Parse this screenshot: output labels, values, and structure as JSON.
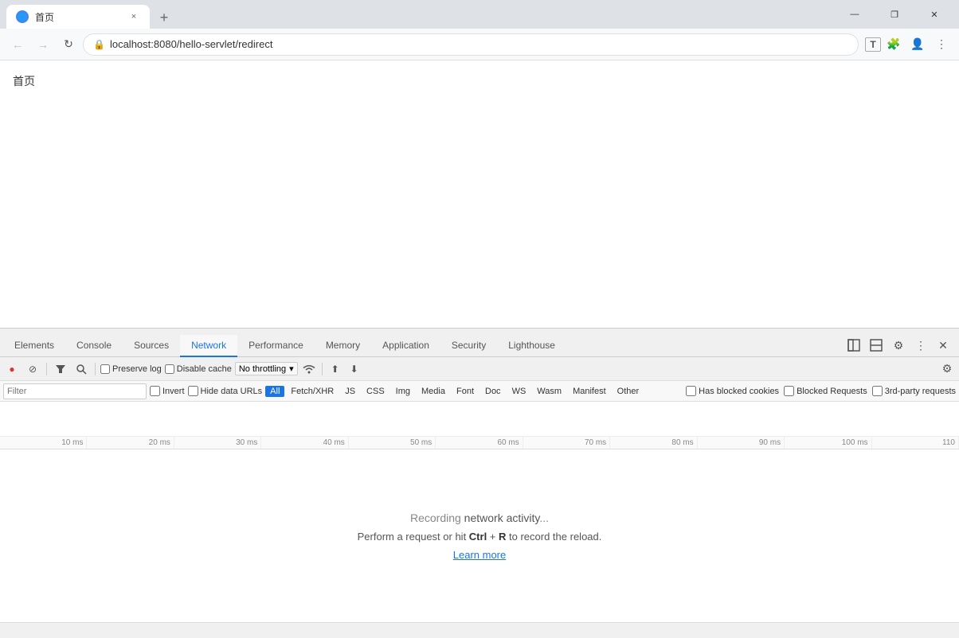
{
  "browser": {
    "tab": {
      "favicon": "🌐",
      "title": "首页",
      "close_label": "×"
    },
    "new_tab_label": "+",
    "window_controls": {
      "minimize": "—",
      "maximize": "□",
      "close": "✕",
      "restore": "❐"
    }
  },
  "address_bar": {
    "back_label": "←",
    "forward_label": "→",
    "reload_label": "↻",
    "url": "localhost:8080/hello-servlet/redirect",
    "lock_icon": "🔒",
    "toolbar": {
      "translate": "T",
      "extensions": "🧩",
      "profile": "👤",
      "menu": "⋮"
    }
  },
  "page": {
    "content": "首页"
  },
  "devtools": {
    "tabs": [
      {
        "id": "elements",
        "label": "Elements"
      },
      {
        "id": "console",
        "label": "Console"
      },
      {
        "id": "sources",
        "label": "Sources"
      },
      {
        "id": "network",
        "label": "Network"
      },
      {
        "id": "performance",
        "label": "Performance"
      },
      {
        "id": "memory",
        "label": "Memory"
      },
      {
        "id": "application",
        "label": "Application"
      },
      {
        "id": "security",
        "label": "Security"
      },
      {
        "id": "lighthouse",
        "label": "Lighthouse"
      }
    ],
    "active_tab": "network",
    "icons": {
      "settings": "⚙",
      "more": "⋮",
      "close": "✕",
      "panel_toggle": "◧",
      "console_toggle": "⊡"
    }
  },
  "network": {
    "toolbar": {
      "record_label": "●",
      "stop_label": "⊘",
      "clear_label": "🚫",
      "filter_label": "▽",
      "search_label": "🔍",
      "preserve_log_label": "Preserve log",
      "disable_cache_label": "Disable cache",
      "throttle_label": "No throttling",
      "throttle_arrow": "▾",
      "online_icon": "📶",
      "import_label": "⬆",
      "export_label": "⬇",
      "settings_label": "⚙"
    },
    "filter": {
      "placeholder": "Filter",
      "invert_label": "Invert",
      "hide_data_urls_label": "Hide data URLs",
      "types": [
        "All",
        "Fetch/XHR",
        "JS",
        "CSS",
        "Img",
        "Media",
        "Font",
        "Doc",
        "WS",
        "Wasm",
        "Manifest",
        "Other"
      ],
      "active_type": "All",
      "has_blocked_cookies_label": "Has blocked cookies",
      "blocked_requests_label": "Blocked Requests",
      "third_party_label": "3rd-party requests"
    },
    "timeline": {
      "labels": [
        "10 ms",
        "20 ms",
        "30 ms",
        "40 ms",
        "50 ms",
        "60 ms",
        "70 ms",
        "80 ms",
        "90 ms",
        "100 ms",
        "110"
      ]
    },
    "empty_state": {
      "recording_line": "Recording network activity...",
      "hint_line_before": "Perform a request or hit ",
      "hint_ctrl": "Ctrl",
      "hint_plus": " + ",
      "hint_r": "R",
      "hint_line_after": " to record the reload.",
      "learn_more": "Learn more"
    }
  },
  "status_bar": {
    "text": ""
  }
}
